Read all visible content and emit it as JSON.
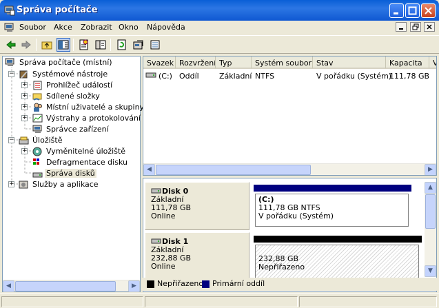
{
  "window": {
    "title": "Správa počítače"
  },
  "menu": [
    "Soubor",
    "Akce",
    "Zobrazit",
    "Okno",
    "Nápověda"
  ],
  "toolbar": [
    "back-icon",
    "forward-icon",
    "up-folder-icon",
    "show-tree-icon",
    "properties-icon",
    "help-pane-icon",
    "refresh-icon",
    "settings-icon",
    "export-icon"
  ],
  "tree": {
    "root": "Správa počítače (místní)",
    "system_tools": "Systémové nástroje",
    "event_viewer": "Prohlížeč událostí",
    "shared_folders": "Sdílené složky",
    "local_users": "Místní uživatelé a skupiny",
    "alerts": "Výstrahy a protokolování vý",
    "device_manager": "Správce zařízení",
    "storage": "Úložiště",
    "removable": "Vyměnitelné úložiště",
    "defrag": "Defragmentace disku",
    "disk_mgmt": "Správa disků",
    "services": "Služby a aplikace"
  },
  "volume_list": {
    "columns": [
      "Svazek",
      "Rozvržení",
      "Typ",
      "Systém souborů",
      "Stav",
      "Kapacita",
      "V"
    ],
    "rows": [
      {
        "volume": "(C:)",
        "layout": "Oddíl",
        "type": "Základní",
        "fs": "NTFS",
        "status": "V pořádku (Systém)",
        "capacity": "111,78 GB"
      }
    ]
  },
  "disks": [
    {
      "name": "Disk 0",
      "type": "Základní",
      "size": "111,78 GB",
      "state": "Online",
      "partition": {
        "label": "(C:)",
        "detail": "111,78 GB NTFS",
        "status": "V pořádku (Systém)",
        "color": "#00007f"
      }
    },
    {
      "name": "Disk 1",
      "type": "Základní",
      "size": "232,88 GB",
      "state": "Online",
      "partition": {
        "label": "",
        "detail": "232,88 GB",
        "status": "Nepřiřazeno",
        "color": "#000000"
      }
    }
  ],
  "legend": [
    {
      "label": "Nepřiřazeno",
      "color": "#000000"
    },
    {
      "label": "Primární oddíl",
      "color": "#00007f"
    }
  ]
}
